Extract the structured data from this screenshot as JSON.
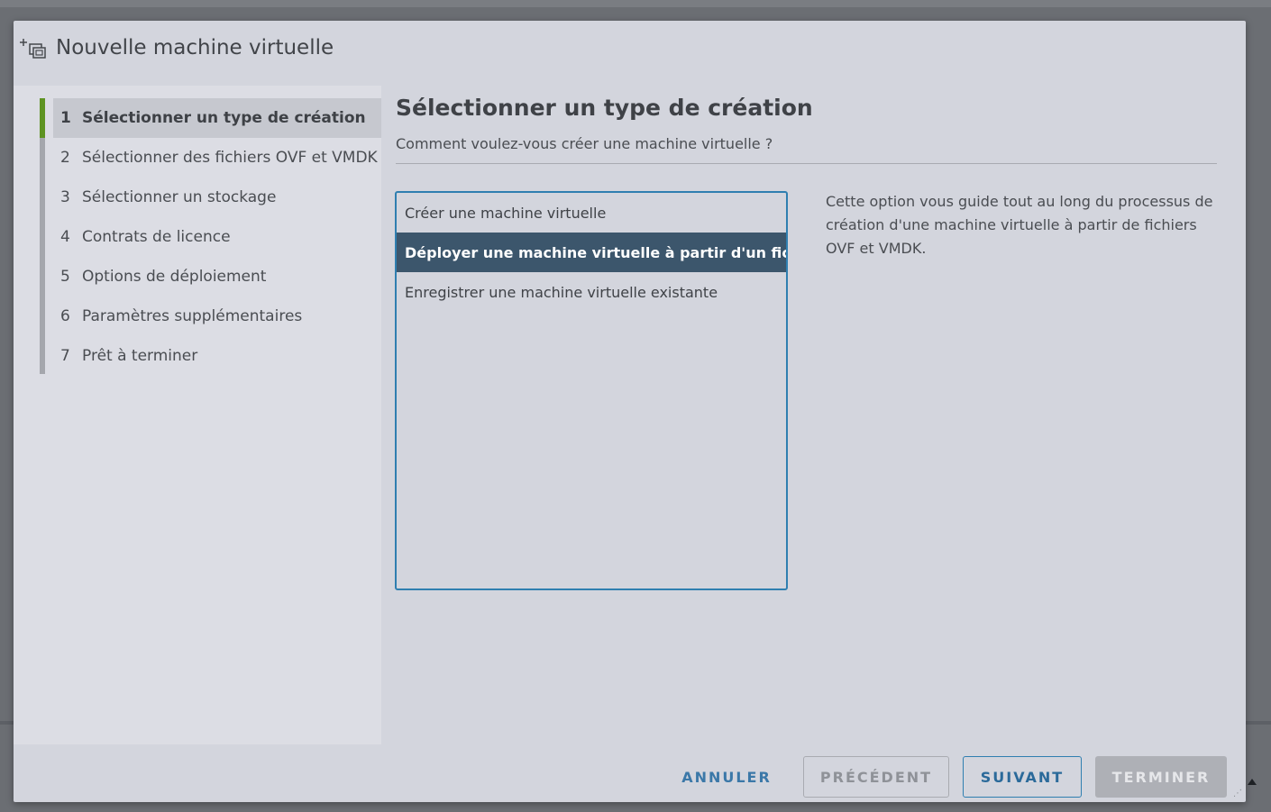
{
  "dialog": {
    "title": "Nouvelle machine virtuelle",
    "icon": "add-vm-icon"
  },
  "steps": [
    {
      "num": "1",
      "label": "Sélectionner un type de création",
      "active": true
    },
    {
      "num": "2",
      "label": "Sélectionner des fichiers OVF et VMDK",
      "active": false
    },
    {
      "num": "3",
      "label": "Sélectionner un stockage",
      "active": false
    },
    {
      "num": "4",
      "label": "Contrats de licence",
      "active": false
    },
    {
      "num": "5",
      "label": "Options de déploiement",
      "active": false
    },
    {
      "num": "6",
      "label": "Paramètres supplémentaires",
      "active": false
    },
    {
      "num": "7",
      "label": "Prêt à terminer",
      "active": false
    }
  ],
  "main": {
    "title": "Sélectionner un type de création",
    "subtitle": "Comment voulez-vous créer une machine virtuelle ?",
    "options": [
      {
        "label": "Créer une machine virtuelle",
        "selected": false
      },
      {
        "label": "Déployer une machine virtuelle à partir d'un fichier OVF ou OVA",
        "selected": true
      },
      {
        "label": "Enregistrer une machine virtuelle existante",
        "selected": false
      }
    ],
    "description": "Cette option vous guide tout au long du processus de création d'une machine virtuelle à partir de fichiers OVF et VMDK."
  },
  "footer": {
    "cancel": "ANNULER",
    "previous": "PRÉCÉDENT",
    "next": "SUIVANT",
    "finish": "TERMINER"
  },
  "colors": {
    "accent": "#2f7fb0",
    "active_step": "#5e9322",
    "selected_row": "#3c566c"
  }
}
